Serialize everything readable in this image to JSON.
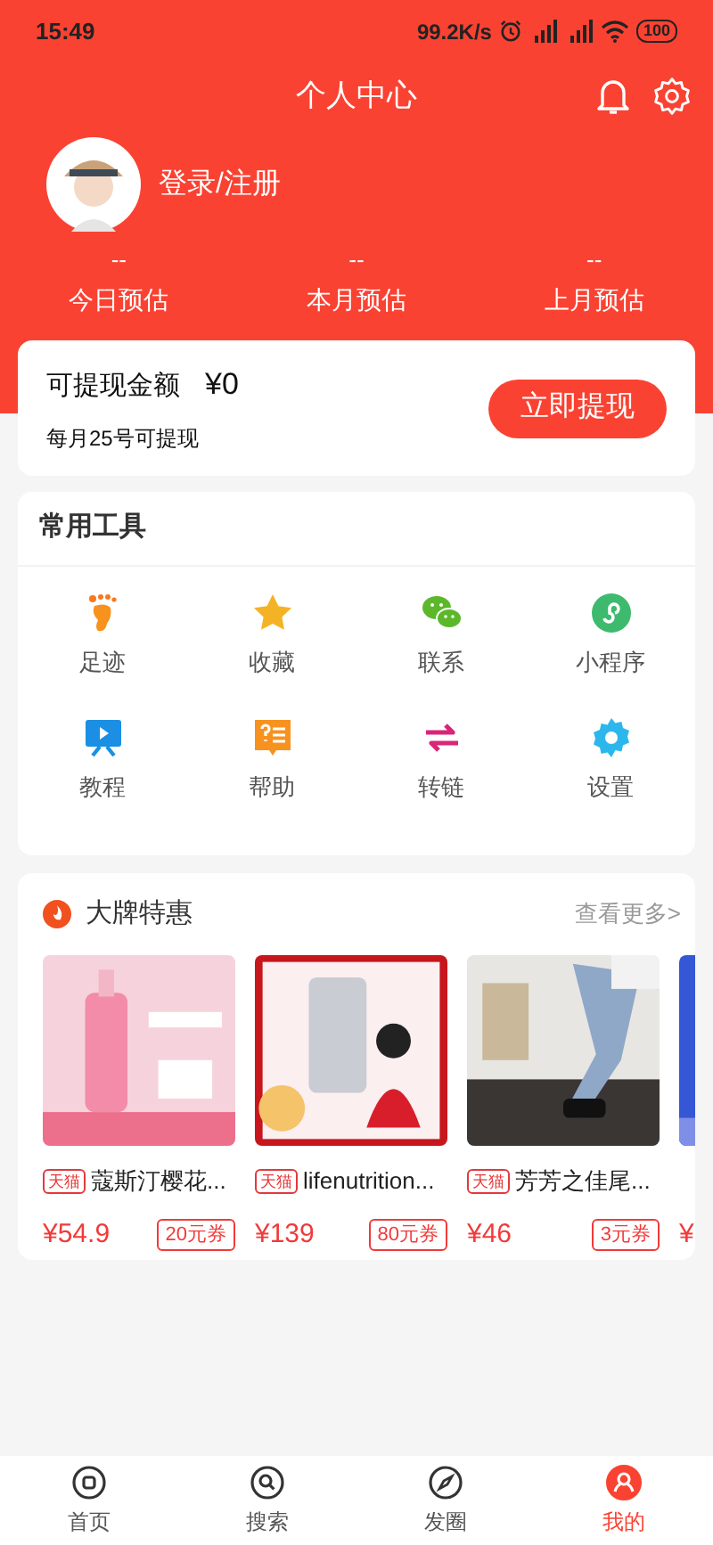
{
  "status_bar": {
    "time": "15:49",
    "speed": "99.2K/s",
    "battery": "100"
  },
  "header": {
    "title": "个人中心"
  },
  "profile": {
    "login": "登录/注册"
  },
  "stats": [
    {
      "value": "--",
      "label": "今日预估"
    },
    {
      "value": "--",
      "label": "本月预估"
    },
    {
      "value": "--",
      "label": "上月预估"
    }
  ],
  "withdraw": {
    "label": "可提现金额",
    "amount": "¥0",
    "note": "每月25号可提现",
    "button": "立即提现"
  },
  "tools": {
    "title": "常用工具",
    "items": [
      "足迹",
      "收藏",
      "联系",
      "小程序",
      "教程",
      "帮助",
      "转链",
      "设置"
    ]
  },
  "brand_deals": {
    "title": "大牌特惠",
    "more": "查看更多>",
    "products": [
      {
        "tag": "天猫",
        "name": "蔻斯汀樱花...",
        "price": "¥54.9",
        "coupon": "20元券"
      },
      {
        "tag": "天猫",
        "name": "lifenutrition...",
        "price": "¥139",
        "coupon": "80元券"
      },
      {
        "tag": "天猫",
        "name": "芳芳之佳尾...",
        "price": "¥46",
        "coupon": "3元券"
      },
      {
        "price": "¥"
      }
    ]
  },
  "bottom_nav": [
    {
      "label": "首页",
      "selected": false
    },
    {
      "label": "搜索",
      "selected": false
    },
    {
      "label": "发圈",
      "selected": false
    },
    {
      "label": "我的",
      "selected": true
    }
  ]
}
